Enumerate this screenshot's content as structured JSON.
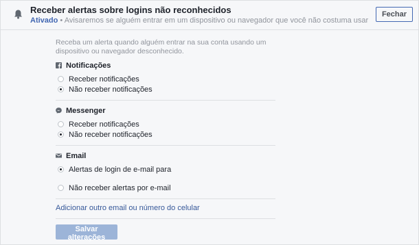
{
  "header": {
    "title": "Receber alertas sobre logins não reconhecidos",
    "status": "Ativado",
    "separator": " • ",
    "subtitle": "Avisaremos se alguém entrar em um dispositivo ou navegador que você não costuma usar",
    "close_label": "Fechar"
  },
  "description": "Receba um alerta quando alguém entrar na sua conta usando um dispositivo ou navegador desconhecido.",
  "sections": [
    {
      "title": "Notificações",
      "icon": "facebook-icon",
      "options": [
        {
          "label": "Receber notificações",
          "checked": false
        },
        {
          "label": "Não receber notificações",
          "checked": true
        }
      ]
    },
    {
      "title": "Messenger",
      "icon": "messenger-icon",
      "options": [
        {
          "label": "Receber notificações",
          "checked": false
        },
        {
          "label": "Não receber notificações",
          "checked": true
        }
      ]
    },
    {
      "title": "Email",
      "icon": "envelope-icon",
      "options": [
        {
          "label": "Alertas de login de e-mail para",
          "checked": true
        },
        {
          "label": "Não receber alertas por e-mail",
          "checked": false
        }
      ]
    }
  ],
  "add_link": "Adicionar outro email ou número do celular",
  "save_label": "Salvar alterações",
  "colors": {
    "accent": "#4267b2",
    "link": "#365899",
    "save_disabled": "#9cb4d8",
    "background": "#f6f7f9",
    "divider": "#dddfe2"
  }
}
